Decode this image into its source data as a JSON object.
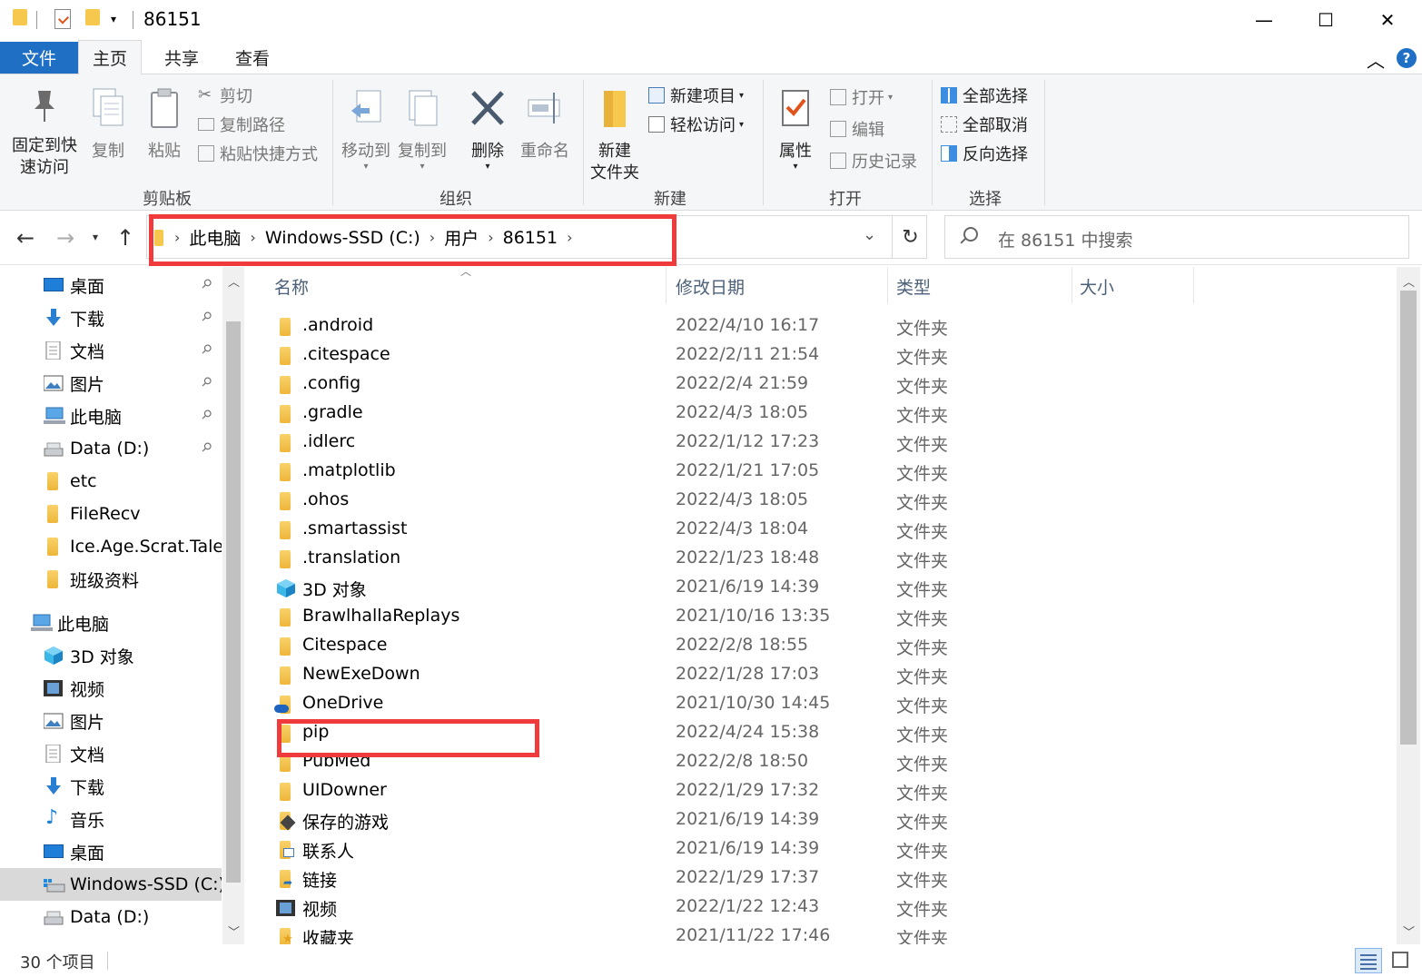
{
  "window": {
    "title": "86151",
    "minimize": "—",
    "maximize": "☐",
    "close": "✕"
  },
  "tabs": {
    "file": "文件",
    "home": "主页",
    "share": "共享",
    "view": "查看"
  },
  "ribbon": {
    "clipboard": {
      "pin_label_1": "固定到快",
      "pin_label_2": "速访问",
      "copy": "复制",
      "paste": "粘贴",
      "cut": "剪切",
      "copy_path": "复制路径",
      "paste_shortcut": "粘贴快捷方式",
      "group": "剪贴板"
    },
    "organize": {
      "move_to": "移动到",
      "copy_to": "复制到",
      "delete": "删除",
      "rename": "重命名",
      "group": "组织"
    },
    "new": {
      "new_folder_1": "新建",
      "new_folder_2": "文件夹",
      "new_item": "新建项目",
      "easy_access": "轻松访问",
      "group": "新建"
    },
    "open": {
      "properties": "属性",
      "open": "打开",
      "edit": "编辑",
      "history": "历史记录",
      "group": "打开"
    },
    "select": {
      "select_all": "全部选择",
      "select_none": "全部取消",
      "invert": "反向选择",
      "group": "选择"
    }
  },
  "address": {
    "crumbs": [
      "此电脑",
      "Windows-SSD (C:)",
      "用户",
      "86151"
    ],
    "search_placeholder": "在 86151 中搜索"
  },
  "nav_pane": {
    "quick_access": [
      {
        "label": "桌面",
        "icon": "desktop-icon",
        "pinned": true
      },
      {
        "label": "下载",
        "icon": "download-icon",
        "pinned": true
      },
      {
        "label": "文档",
        "icon": "document-icon",
        "pinned": true
      },
      {
        "label": "图片",
        "icon": "picture-icon",
        "pinned": true
      },
      {
        "label": "此电脑",
        "icon": "computer-icon",
        "pinned": true
      },
      {
        "label": "Data (D:)",
        "icon": "drive-icon",
        "pinned": true
      },
      {
        "label": "etc",
        "icon": "folder-icon",
        "pinned": false
      },
      {
        "label": "FileRecv",
        "icon": "folder-icon",
        "pinned": false
      },
      {
        "label": "Ice.Age.Scrat.Tales.S",
        "icon": "folder-icon",
        "pinned": false
      },
      {
        "label": "班级资料",
        "icon": "folder-icon",
        "pinned": false
      }
    ],
    "this_pc_label": "此电脑",
    "this_pc": [
      {
        "label": "3D 对象",
        "icon": "3d-objects-icon"
      },
      {
        "label": "视频",
        "icon": "video-icon"
      },
      {
        "label": "图片",
        "icon": "picture-icon"
      },
      {
        "label": "文档",
        "icon": "document-icon"
      },
      {
        "label": "下载",
        "icon": "download-icon"
      },
      {
        "label": "音乐",
        "icon": "music-icon"
      },
      {
        "label": "桌面",
        "icon": "desktop-icon"
      },
      {
        "label": "Windows-SSD (C:)",
        "icon": "system-drive-icon",
        "selected": true
      },
      {
        "label": "Data (D:)",
        "icon": "drive-icon"
      }
    ]
  },
  "file_list": {
    "columns": {
      "name": "名称",
      "date": "修改日期",
      "type": "类型",
      "size": "大小"
    },
    "rows": [
      {
        "name": ".android",
        "date": "2022/4/10 16:17",
        "type": "文件夹",
        "icon": "folder-icon"
      },
      {
        "name": ".citespace",
        "date": "2022/2/11 21:54",
        "type": "文件夹",
        "icon": "folder-icon"
      },
      {
        "name": ".config",
        "date": "2022/2/4 21:59",
        "type": "文件夹",
        "icon": "folder-icon"
      },
      {
        "name": ".gradle",
        "date": "2022/4/3 18:05",
        "type": "文件夹",
        "icon": "folder-icon"
      },
      {
        "name": ".idlerc",
        "date": "2022/1/12 17:23",
        "type": "文件夹",
        "icon": "folder-icon"
      },
      {
        "name": ".matplotlib",
        "date": "2022/1/21 17:05",
        "type": "文件夹",
        "icon": "folder-icon"
      },
      {
        "name": ".ohos",
        "date": "2022/4/3 18:05",
        "type": "文件夹",
        "icon": "folder-icon"
      },
      {
        "name": ".smartassist",
        "date": "2022/4/3 18:04",
        "type": "文件夹",
        "icon": "folder-icon"
      },
      {
        "name": ".translation",
        "date": "2022/1/23 18:48",
        "type": "文件夹",
        "icon": "folder-icon"
      },
      {
        "name": "3D 对象",
        "date": "2021/6/19 14:39",
        "type": "文件夹",
        "icon": "3d-objects-icon"
      },
      {
        "name": "BrawlhallaReplays",
        "date": "2021/10/16 13:35",
        "type": "文件夹",
        "icon": "folder-icon"
      },
      {
        "name": "Citespace",
        "date": "2022/2/8 18:55",
        "type": "文件夹",
        "icon": "folder-icon"
      },
      {
        "name": "NewExeDown",
        "date": "2022/1/28 17:03",
        "type": "文件夹",
        "icon": "folder-icon"
      },
      {
        "name": "OneDrive",
        "date": "2021/10/30 14:45",
        "type": "文件夹",
        "icon": "onedrive-icon"
      },
      {
        "name": "pip",
        "date": "2022/4/24 15:38",
        "type": "文件夹",
        "icon": "folder-icon"
      },
      {
        "name": "PubMed",
        "date": "2022/2/8 18:50",
        "type": "文件夹",
        "icon": "folder-icon"
      },
      {
        "name": "UIDowner",
        "date": "2022/1/29 17:32",
        "type": "文件夹",
        "icon": "folder-icon"
      },
      {
        "name": "保存的游戏",
        "date": "2021/6/19 14:39",
        "type": "文件夹",
        "icon": "saved-games-icon"
      },
      {
        "name": "联系人",
        "date": "2021/6/19 14:39",
        "type": "文件夹",
        "icon": "contacts-icon"
      },
      {
        "name": "链接",
        "date": "2022/1/29 17:37",
        "type": "文件夹",
        "icon": "links-icon"
      },
      {
        "name": "视频",
        "date": "2022/1/22 12:43",
        "type": "文件夹",
        "icon": "video-icon"
      },
      {
        "name": "收藏夹",
        "date": "2021/11/22 17:46",
        "type": "文件夹",
        "icon": "favorites-icon"
      }
    ]
  },
  "status": {
    "item_count": "30 个项目"
  },
  "colors": {
    "accent": "#1f6fc5",
    "highlight_box": "#ef3b3b",
    "folder": "#f6c94e"
  }
}
